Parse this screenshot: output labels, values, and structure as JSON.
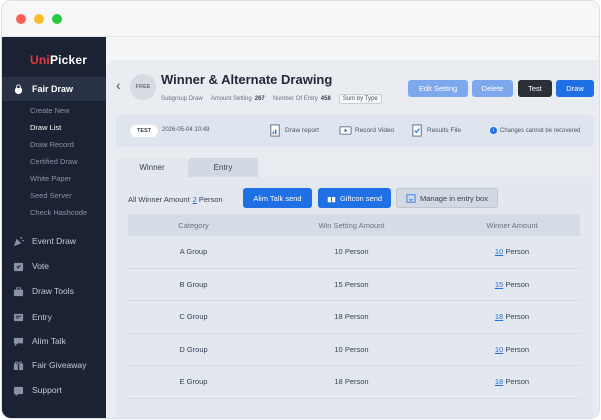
{
  "app": {
    "logo_part1": "Uni",
    "logo_part2": "Picker"
  },
  "sidebar": {
    "active_section": "Fair Draw",
    "subitems": [
      "Create New",
      "Draw List",
      "Draw Record",
      "Certified Draw",
      "White Paper",
      "Seed Server",
      "Check Hashcode"
    ],
    "active_subitem": "Draw List",
    "items": [
      "Event Draw",
      "Vote",
      "Draw Tools",
      "Entry",
      "Alim Talk",
      "Fair Giveaway",
      "Support"
    ]
  },
  "header": {
    "free_badge": "FREE",
    "title": "Winner & Alternate Drawing",
    "subgroup_label": "Subgroup Draw",
    "amount_setting_label": "Amount Setting",
    "amount_setting_value": "267",
    "entry_label": "Number Of Entry",
    "entry_value": "458",
    "sort_label": "Sum by Type",
    "buttons": {
      "edit": "Edit Setting",
      "delete": "Delete",
      "test": "Test",
      "draw": "Draw"
    }
  },
  "infobar": {
    "badge": "TEST",
    "datetime": "2026-05-04 10:49",
    "draw_report": "Draw report",
    "record_video": "Record Video",
    "results_file": "Results File",
    "notice": "Changes cannot be recovered"
  },
  "tabs": {
    "winner": "Winner",
    "entry": "Entry"
  },
  "summary": {
    "label": "All Winner Amount",
    "count": "2",
    "unit": "Person"
  },
  "actions": {
    "alim": "Alim Talk send",
    "gift": "Giftcon send",
    "entrybox": "Manage in entry box"
  },
  "table": {
    "headers": [
      "Category",
      "Win Setting Amount",
      "Winner Amount"
    ],
    "rows": [
      {
        "category": "A Group",
        "setting": "10 Person",
        "winner_num": "10",
        "winner_unit": "Person"
      },
      {
        "category": "B Group",
        "setting": "15 Person",
        "winner_num": "15",
        "winner_unit": "Person"
      },
      {
        "category": "C Group",
        "setting": "18 Person",
        "winner_num": "18",
        "winner_unit": "Person"
      },
      {
        "category": "D Group",
        "setting": "10 Person",
        "winner_num": "10",
        "winner_unit": "Person"
      },
      {
        "category": "E Group",
        "setting": "18 Person",
        "winner_num": "18",
        "winner_unit": "Person"
      }
    ]
  },
  "colors": {
    "primary": "#1f6fe5",
    "sidebar": "#1b2233",
    "logo_accent": "#e23b3b"
  }
}
